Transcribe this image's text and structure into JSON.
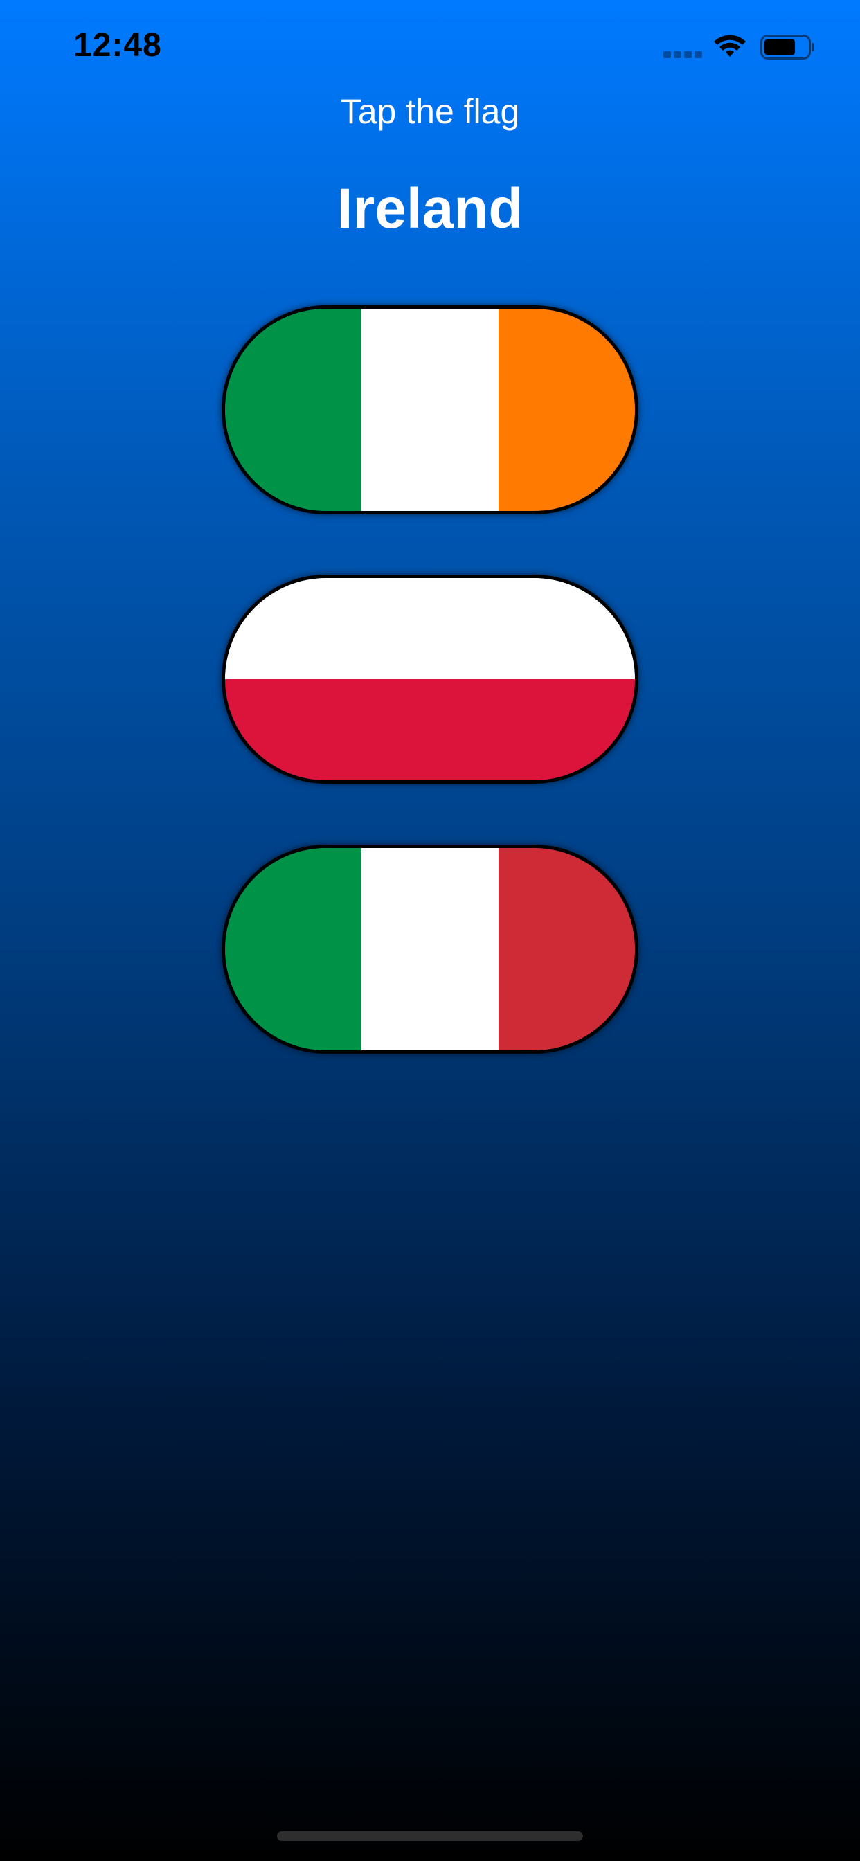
{
  "status_bar": {
    "time": "12:48",
    "icons": [
      "signal-icon",
      "wifi-icon",
      "battery-icon"
    ]
  },
  "game": {
    "prompt": "Tap the flag",
    "country": "Ireland"
  },
  "flags": [
    {
      "country": "Ireland",
      "orientation": "vertical",
      "stripes": [
        "#009246",
        "#ffffff",
        "#ff7a00"
      ]
    },
    {
      "country": "Poland",
      "orientation": "horizontal",
      "stripes": [
        "#ffffff",
        "#dc143c"
      ]
    },
    {
      "country": "Italy",
      "orientation": "vertical",
      "stripes": [
        "#009246",
        "#ffffff",
        "#ce2b37"
      ]
    }
  ],
  "colors": {
    "background_top": "#007aff",
    "background_bottom": "#000000",
    "text": "#ffffff"
  }
}
